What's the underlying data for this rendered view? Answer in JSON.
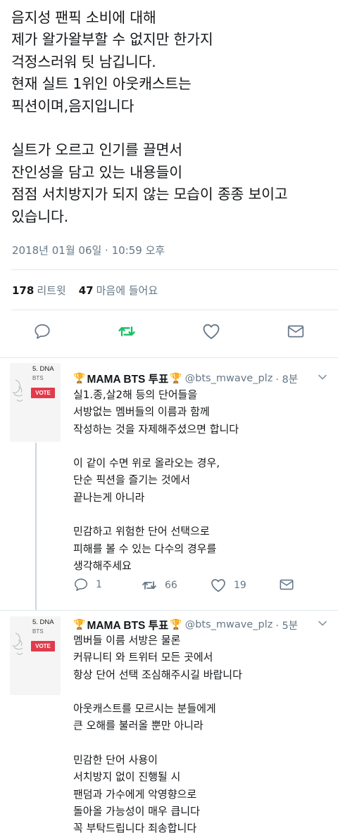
{
  "tweet": {
    "text_lines": [
      "음지성 팬픽 소비에 대해",
      "제가 왈가왈부할 수 없지만 한가지",
      "걱정스러워 팃 남깁니다.",
      "현재 실트 1위인 아웃캐스트는",
      "픽션이며,음지입니다",
      "",
      "실트가 오르고 인기를 끌면서",
      "잔인성을 담고 있는 내용들이",
      "점점 서치방지가 되지 않는 모습이 종종 보이고",
      "있습니다."
    ],
    "timestamp": "2018년 01월 06일 · 10:59 오후",
    "retweets_count": "178",
    "retweets_label": "리트윗",
    "likes_count": "47",
    "likes_label": "마음에 들어요",
    "action_icons": [
      "reply-icon",
      "retweet-icon",
      "heart-icon",
      "envelope-icon"
    ],
    "retweet_color": "#17bf63"
  },
  "replies": [
    {
      "avatar": {
        "rank": "5. DNA",
        "group": "BTS",
        "vote": "VOTE"
      },
      "name": "MAMA BTS 투표",
      "trophy_left": "🏆",
      "trophy_right": "🏆",
      "handle": "@bts_mwave_plz",
      "time": "· 8분",
      "text_lines": [
        "실1.종,살2해 등의 단어들을",
        "서방없는 멤버들의 이름과 함께",
        "작성하는 것을 자제해주셨으면 합니다",
        "",
        "이 같이 수면 위로 올라오는 경우,",
        "단순 픽션을 즐기는 것에서",
        "끝나는게 아니라",
        "",
        "민감하고 위험한 단어 선택으로",
        "피해를 볼 수 있는 다수의 경우를",
        "생각해주세요"
      ],
      "reply_count": "1",
      "retweet_count": "66",
      "like_count": "19"
    },
    {
      "avatar": {
        "rank": "5. DNA",
        "group": "BTS",
        "vote": "VOTE"
      },
      "name": "MAMA BTS 투표",
      "trophy_left": "🏆",
      "trophy_right": "🏆",
      "handle": "@bts_mwave_plz",
      "time": "· 5분",
      "text_lines": [
        "멤버들 이름 서방은 물론",
        "커뮤니티 와 트위터 모든 곳에서",
        "항상 단어 선택 조심해주시길 바랍니다",
        "",
        "아웃캐스트를 모르시는 분들에게",
        "큰 오해를 불러올 뿐만 아니라",
        "",
        "민감한 단어 사용이",
        "서치방지 없이 진행될 시",
        "팬덤과 가수에게 악영향으로",
        "돌아올 가능성이 매우 큽니다",
        "꼭 부탁드립니다 죄송합니다"
      ]
    }
  ]
}
